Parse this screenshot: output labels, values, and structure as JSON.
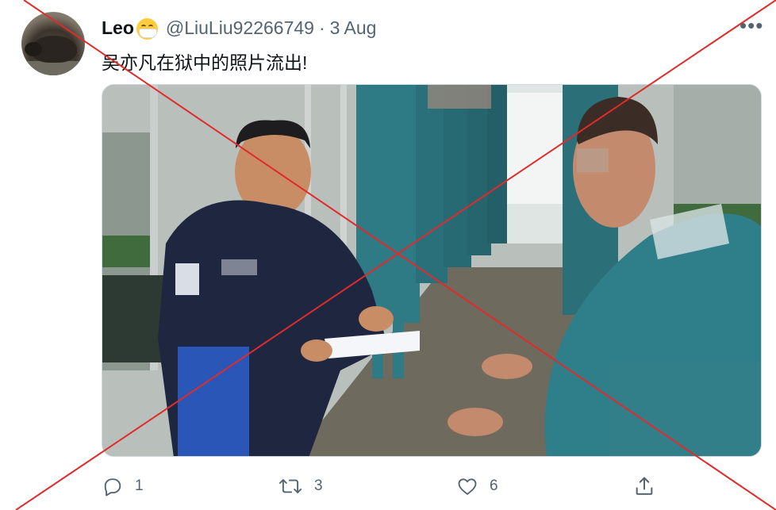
{
  "tweet": {
    "display_name": "Leo",
    "handle": "@LiuLiu92266749",
    "separator": "·",
    "date": "3 Aug",
    "more_icon": "more-horizontal-icon",
    "text": "吴亦凡在狱中的照片流出!"
  },
  "media": {
    "image_description": "prison photo"
  },
  "actions": {
    "reply_count": "1",
    "retweet_count": "3",
    "like_count": "6"
  },
  "overlay": {
    "color": "#e02b2b"
  }
}
